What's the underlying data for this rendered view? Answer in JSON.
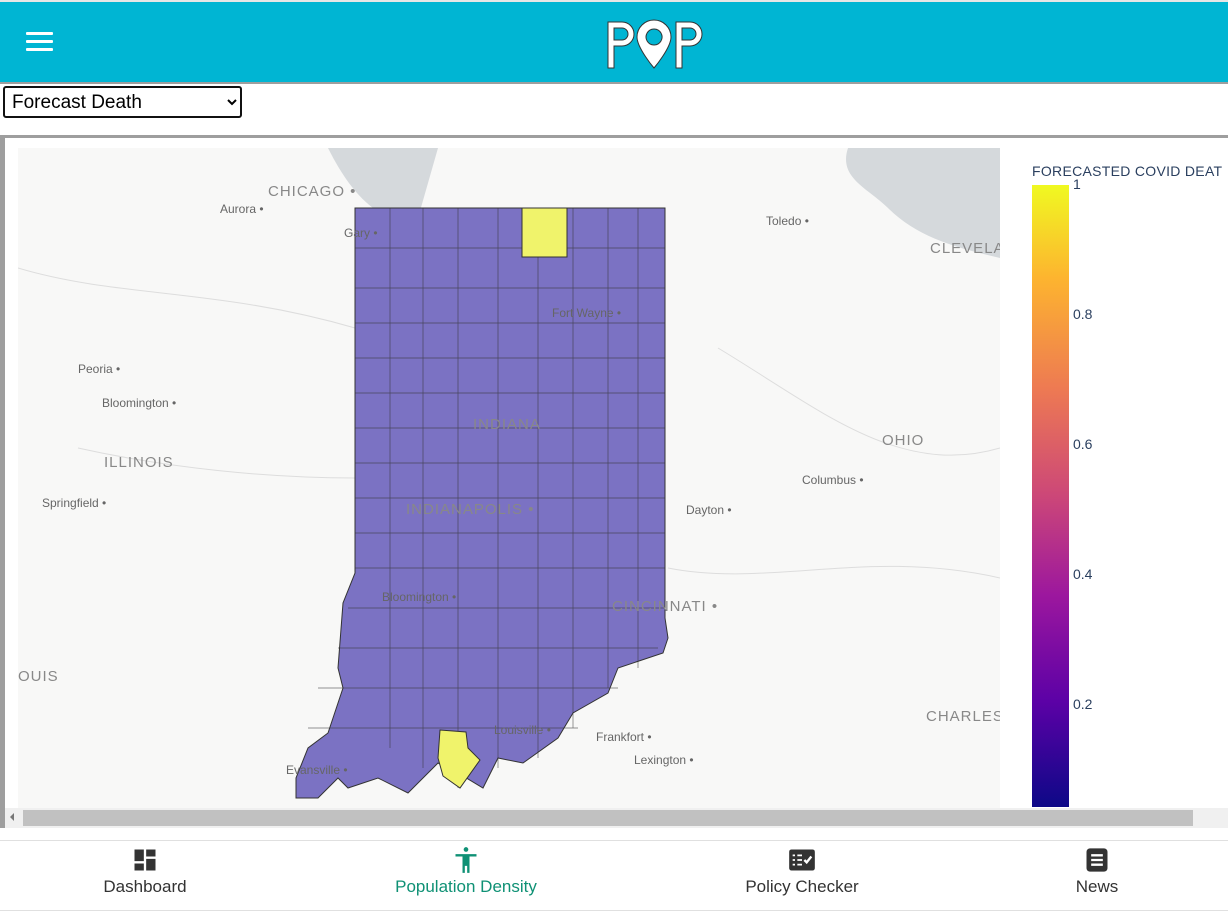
{
  "header": {
    "logo_text": "POP",
    "menu_icon": "hamburger-icon"
  },
  "selector": {
    "value": "Forecast Death",
    "options": [
      "Forecast Death"
    ]
  },
  "map": {
    "state_fill": "#7b72c3",
    "highlight_fill": "#f0f36b",
    "labels": [
      {
        "text": "CHICAGO",
        "kind": "big"
      },
      {
        "text": "Aurora"
      },
      {
        "text": "Gary"
      },
      {
        "text": "Toledo"
      },
      {
        "text": "CLEVELAN",
        "kind": "big"
      },
      {
        "text": "Fort Wayne"
      },
      {
        "text": "Peoria"
      },
      {
        "text": "Bloomington"
      },
      {
        "text": "INDIANA",
        "kind": "big"
      },
      {
        "text": "OHIO",
        "kind": "big"
      },
      {
        "text": "ILLINOIS",
        "kind": "big"
      },
      {
        "text": "Columbus"
      },
      {
        "text": "Springfield"
      },
      {
        "text": "INDIANAPOLIS",
        "kind": "big"
      },
      {
        "text": "Dayton"
      },
      {
        "text": "Bloomington"
      },
      {
        "text": "CINCINNATI",
        "kind": "big"
      },
      {
        "text": "OUIS",
        "kind": "big"
      },
      {
        "text": "CHARLEST",
        "kind": "big"
      },
      {
        "text": "Louisville"
      },
      {
        "text": "Frankfort"
      },
      {
        "text": "Lexington"
      },
      {
        "text": "Evansville"
      }
    ]
  },
  "colorbar": {
    "title": "FORECASTED COVID DEAT",
    "colorscale": "plasma",
    "ticks": [
      "1",
      "0.8",
      "0.6",
      "0.4",
      "0.2"
    ]
  },
  "bottom_nav": {
    "active_color": "#0f9175",
    "items": [
      {
        "label": "Dashboard",
        "icon": "dashboard-icon"
      },
      {
        "label": "Population Density",
        "icon": "person-icon",
        "active": true
      },
      {
        "label": "Policy Checker",
        "icon": "checklist-icon"
      },
      {
        "label": "News",
        "icon": "news-icon"
      }
    ]
  }
}
